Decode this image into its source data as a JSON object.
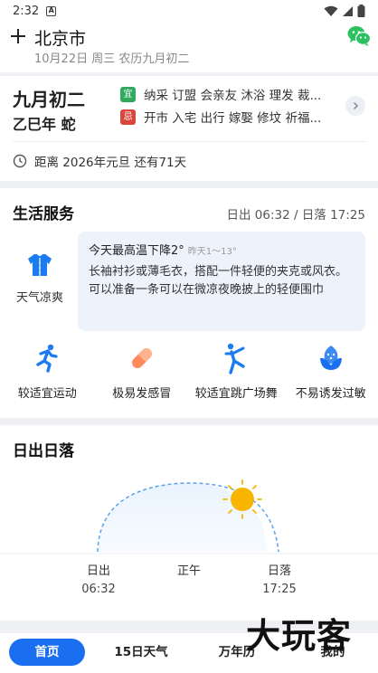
{
  "status_bar": {
    "time": "2:32"
  },
  "header": {
    "city": "北京市",
    "date_line": "10月22日 周三 农历九月初二"
  },
  "almanac": {
    "lunar_day": "九月初二",
    "lunar_year": "乙巳年 蛇",
    "yi_badge": "宜",
    "yi_text": "纳采 订盟 会亲友 沐浴 理发 裁...",
    "ji_badge": "忌",
    "ji_text": "开市 入宅 出行 嫁娶 修坟 祈福...",
    "countdown": "距离 2026年元旦 还有71天"
  },
  "life_service": {
    "title": "生活服务",
    "sun_times": "日出 06:32 / 日落 17:25",
    "weather_label": "天气凉爽",
    "tip_head": "今天最高温下降2°",
    "tip_sub": "昨天1～13°",
    "tip_body": "长袖衬衫或薄毛衣，搭配一件轻便的夹克或风衣。可以准备一条可以在微凉夜晚披上的轻便围巾",
    "items": [
      {
        "label": "较适宜运动",
        "icon": "running-icon"
      },
      {
        "label": "极易发感冒",
        "icon": "pill-icon"
      },
      {
        "label": "较适宜跳广场舞",
        "icon": "dancing-icon"
      },
      {
        "label": "不易诱发过敏",
        "icon": "flower-icon"
      }
    ]
  },
  "sunrise_sunset": {
    "title": "日出日落",
    "sunrise_label": "日出",
    "sunrise_time": "06:32",
    "noon_label": "正午",
    "sunset_label": "日落",
    "sunset_time": "17:25",
    "sun_color": "#f7b500"
  },
  "tab_bar": {
    "tabs": [
      {
        "label": "首页",
        "active": true
      },
      {
        "label": "15日天气",
        "active": false
      },
      {
        "label": "万年历",
        "active": false
      },
      {
        "label": "我的",
        "active": false
      }
    ]
  },
  "watermark": "大玩客",
  "colors": {
    "accent": "#1a6ff0",
    "yi": "#2faa5e",
    "ji": "#d9463e"
  }
}
